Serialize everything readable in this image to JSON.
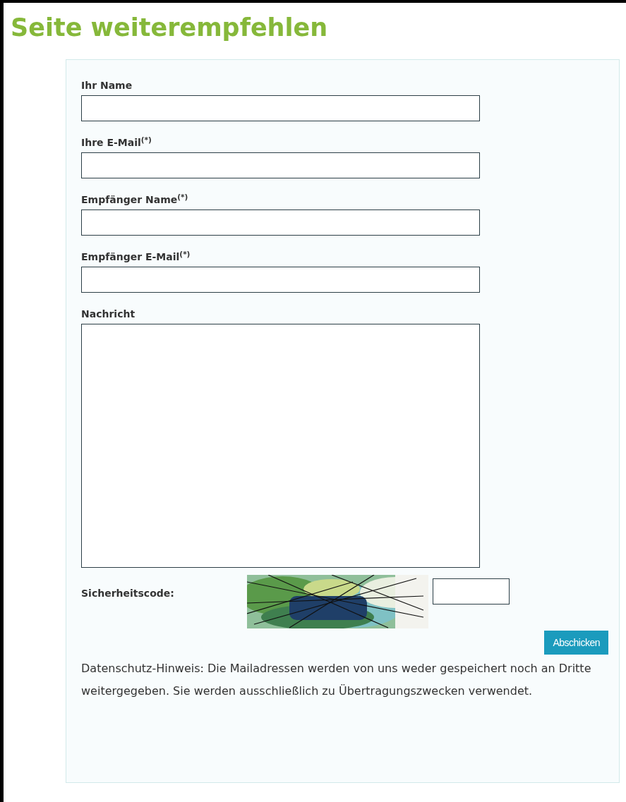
{
  "title": "Seite weiterempfehlen",
  "fields": [
    {
      "label": "Ihr Name",
      "kind": "text"
    },
    {
      "label": "Ihre E-Mail$^{(*)}$",
      "kind": "text"
    },
    {
      "label": "Empfänger Name$^{(*)}$",
      "kind": "text"
    },
    {
      "label": "Empfänger E-Mail$^{(*)}$",
      "kind": "text"
    },
    {
      "label": "Nachricht",
      "kind": "textarea"
    }
  ],
  "captcha": {
    "label": "Sicherheitscode:"
  },
  "submit": "Abschicken",
  "privacy_note": "Datenschutz-Hinweis: Die Mailadressen werden von uns weder gespeichert noch an Dritte weitergegeben. Sie werden ausschließlich zu Übertragungszwecken verwendet."
}
